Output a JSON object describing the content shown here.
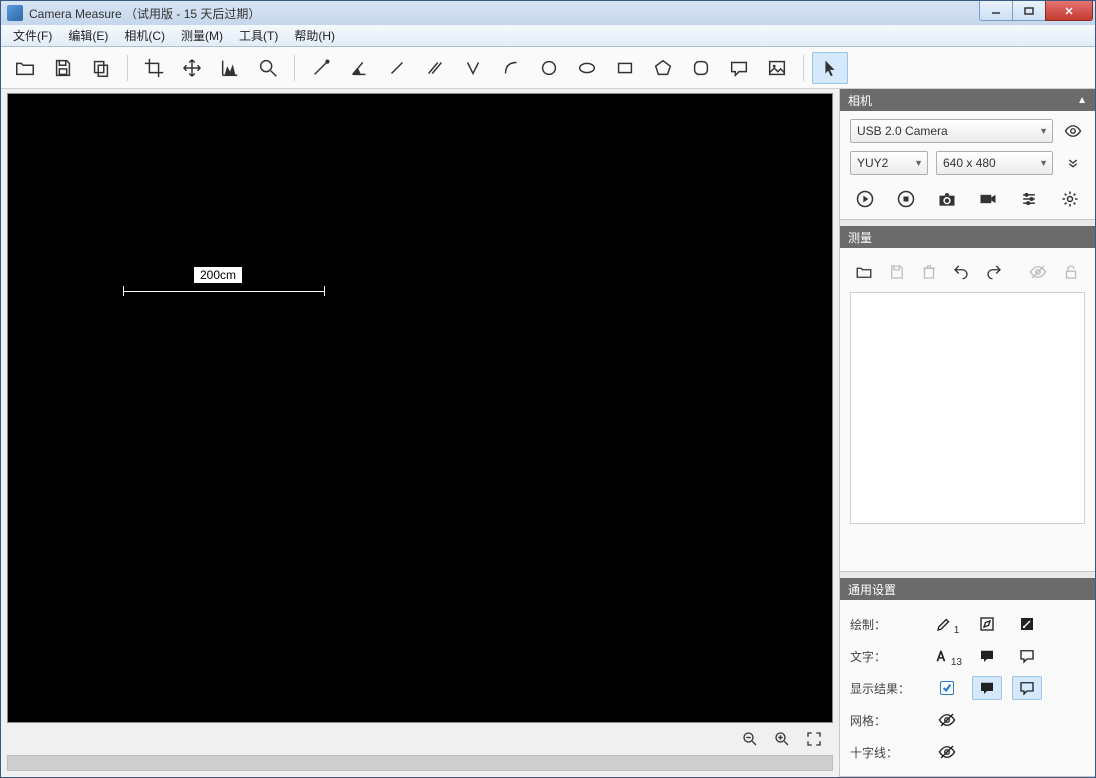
{
  "window": {
    "title": "Camera Measure （试用版 - 15 天后过期）"
  },
  "menu": {
    "file": "文件(F)",
    "edit": "编辑(E)",
    "camera": "相机(C)",
    "measure": "测量(M)",
    "tools": "工具(T)",
    "help": "帮助(H)"
  },
  "canvas": {
    "measurement_label": "200cm"
  },
  "panels": {
    "camera": {
      "title": "相机",
      "device": "USB 2.0 Camera",
      "format": "YUY2",
      "resolution": "640 x 480"
    },
    "measure": {
      "title": "测量"
    },
    "general": {
      "title": "通用设置",
      "draw_label": "绘制：",
      "draw_size": "1",
      "text_label": "文字：",
      "text_size": "13",
      "show_result_label": "显示结果：",
      "grid_label": "网格：",
      "crosshair_label": "十字线："
    }
  }
}
